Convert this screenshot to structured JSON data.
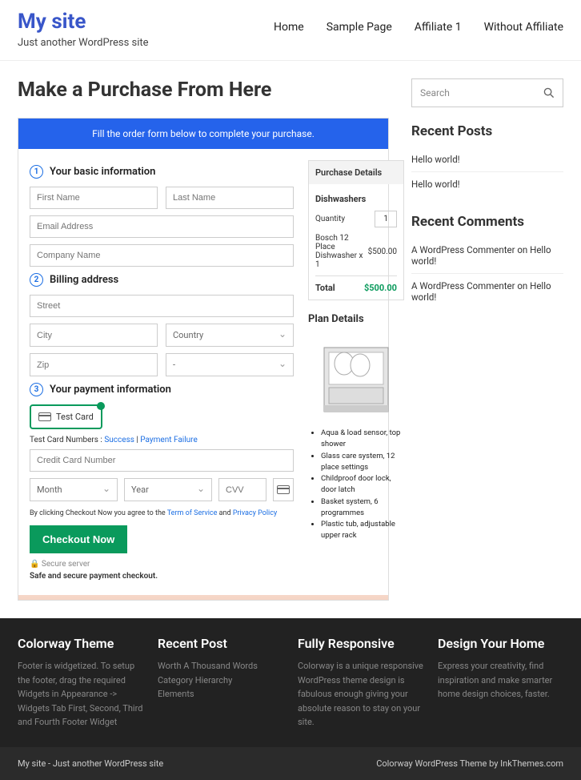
{
  "header": {
    "site_title": "My site",
    "tagline": "Just another WordPress site",
    "nav": [
      "Home",
      "Sample Page",
      "Affiliate 1",
      "Without Affiliate"
    ]
  },
  "page_title": "Make a Purchase From Here",
  "order": {
    "banner": "Fill the order form below to complete your purchase.",
    "step1": "Your basic information",
    "step2": "Billing address",
    "step3": "Your payment information",
    "first_name_ph": "First Name",
    "last_name_ph": "Last Name",
    "email_ph": "Email Address",
    "company_ph": "Company Name",
    "street_ph": "Street",
    "city_ph": "City",
    "country_ph": "Country",
    "zip_ph": "Zip",
    "state_ph": "-",
    "paycard_label": "Test Card",
    "test_numbers_text": "Test Card Numbers : ",
    "test_success": "Success",
    "test_sep": " | ",
    "test_fail": "Payment Failure",
    "cc_ph": "Credit Card Number",
    "month_ph": "Month",
    "year_ph": "Year",
    "cvv_ph": "CVV",
    "terms_pre": "By clicking Checkout Now you agree to the ",
    "terms_tos": "Term of Service",
    "terms_and": " and ",
    "terms_pp": "Privacy Policy",
    "checkout_btn": "Checkout Now",
    "secure_line": "🔒 Secure server",
    "secure_line2": "Safe and secure payment checkout."
  },
  "purchase": {
    "header": "Purchase Details",
    "product_group": "Dishwashers",
    "qty_label": "Quantity",
    "qty_val": "1",
    "item_name": "Bosch 12 Place Dishwasher x 1",
    "item_price": "$500.00",
    "total_label": "Total",
    "total_val": "$500.00",
    "plan_title": "Plan Details",
    "bullets": [
      "Aqua & load sensor, top shower",
      "Glass care system, 12 place settings",
      "Childproof door lock, door latch",
      "Basket system, 6 programmes",
      "Plastic tub, adjustable upper rack"
    ]
  },
  "sidebar": {
    "search_ph": "Search",
    "recent_posts_title": "Recent Posts",
    "recent_posts": [
      "Hello world!",
      "Hello world!"
    ],
    "recent_comments_title": "Recent Comments",
    "recent_comments": [
      "A WordPress Commenter on Hello world!",
      "A WordPress Commenter on Hello world!"
    ]
  },
  "footer": {
    "cols": [
      {
        "title": "Colorway Theme",
        "body": "Footer is widgetized. To setup the footer, drag the required Widgets in Appearance -> Widgets Tab First, Second, Third and Fourth Footer Widget"
      },
      {
        "title": "Recent Post",
        "body": "Worth A Thousand Words\nCategory Hierarchy\nElements"
      },
      {
        "title": "Fully Responsive",
        "body": "Colorway is a unique responsive WordPress theme design is fabulous enough giving your absolute reason to stay on your site."
      },
      {
        "title": "Design Your Home",
        "body": "Express your creativity, find inspiration and make smarter home design choices, faster."
      }
    ],
    "bottom_left": "My site - Just another WordPress site",
    "bottom_right": "Colorway WordPress Theme by InkThemes.com"
  }
}
